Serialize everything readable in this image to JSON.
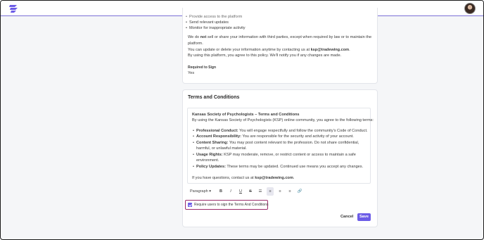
{
  "privacy": {
    "bullets_partial": "Provide access to the platform",
    "bullets": [
      "Send relevant updates",
      "Monitor for inappropriate activity"
    ],
    "disclosure_pre": "We do ",
    "disclosure_bold": "not",
    "disclosure_post": " sell or share your information with third parties, except when required by law or to maintain the",
    "disclosure_line2": "platform.",
    "contact_pre": "You can update or delete your information anytime by contacting us at ",
    "contact_email": "ksp@tradewing.com",
    "contact_post": ".",
    "agree_line": "By using this platform, you agree to this policy. We'll notify you if any changes are made.",
    "required_label": "Required to Sign",
    "required_value": "Yes"
  },
  "terms": {
    "section_title": "Terms and Conditions",
    "doc_title": "Kansas Society of Psychologists – Terms and Conditions",
    "intro": "By using the Kansas Society of Psychologists (KSP) online community, you agree to the following terms:",
    "items": [
      {
        "bold": "Professional Conduct:",
        "text": " You will engage respectfully and follow the community's Code of Conduct."
      },
      {
        "bold": "Account Responsibility:",
        "text": " You are responsible for the security and activity of your account."
      },
      {
        "bold": "Content Sharing:",
        "text": " You may post content relevant to the profession. Do not share confidential,",
        "text2": "harmful, or unlawful material."
      },
      {
        "bold": "Usage Rights:",
        "text": " KSP may moderate, remove, or restrict content or access to maintain a safe",
        "text2": "environment."
      },
      {
        "bold": "Policy Updates:",
        "text": " These terms may be updated. Continued use means you accept any changes."
      }
    ],
    "questions_pre": "If you have questions, contact us at ",
    "questions_email": "ksp@tradewing.com",
    "questions_post": "."
  },
  "toolbar": {
    "format_select": "Paragraph",
    "bold": "B",
    "italic": "I",
    "underline": "U",
    "strike": "S"
  },
  "require_checkbox": {
    "label": "Require users to sign the Terms And Conditions",
    "checked": true
  },
  "actions": {
    "cancel": "Cancel",
    "save": "Save"
  },
  "colors": {
    "accent": "#6c5ce7",
    "highlight_border": "#9b2c6b"
  }
}
